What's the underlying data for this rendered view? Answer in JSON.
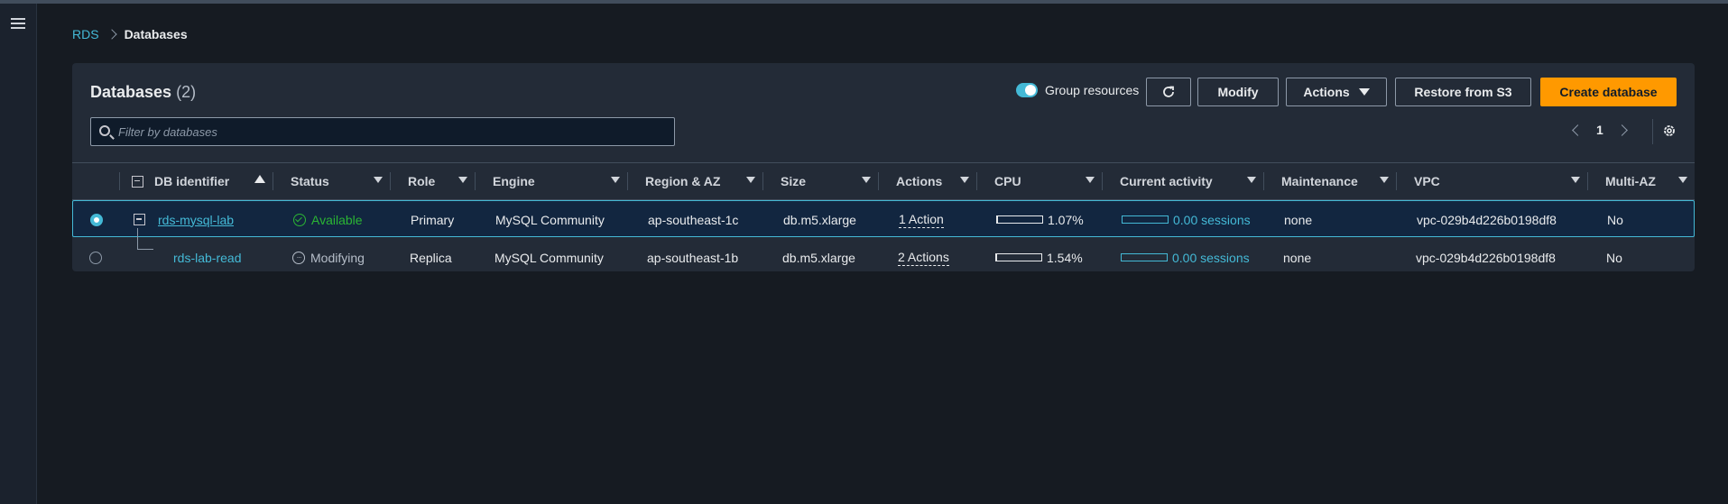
{
  "breadcrumb": {
    "root": "RDS",
    "current": "Databases"
  },
  "panel": {
    "title": "Databases",
    "count": "(2)",
    "group_resources_label": "Group resources",
    "buttons": {
      "modify": "Modify",
      "actions": "Actions",
      "restore": "Restore from S3",
      "create": "Create database"
    },
    "search_placeholder": "Filter by databases",
    "page": "1"
  },
  "columns": [
    "DB identifier",
    "Status",
    "Role",
    "Engine",
    "Region & AZ",
    "Size",
    "Actions",
    "CPU",
    "Current activity",
    "Maintenance",
    "VPC",
    "Multi-AZ"
  ],
  "rows": [
    {
      "id": "rds-mysql-lab",
      "status": "Available",
      "role": "Primary",
      "engine": "MySQL Community",
      "region": "ap-southeast-1c",
      "size": "db.m5.xlarge",
      "actions": "1 Action",
      "cpu": "1.07%",
      "cpu_fraction": 0.0107,
      "activity": "0.00 sessions",
      "maintenance": "none",
      "vpc": "vpc-029b4d226b0198df8",
      "multi_az": "No",
      "selected": true
    },
    {
      "id": "rds-lab-read",
      "status": "Modifying",
      "role": "Replica",
      "engine": "MySQL Community",
      "region": "ap-southeast-1b",
      "size": "db.m5.xlarge",
      "actions": "2 Actions",
      "cpu": "1.54%",
      "cpu_fraction": 0.0154,
      "activity": "0.00 sessions",
      "maintenance": "none",
      "vpc": "vpc-029b4d226b0198df8",
      "multi_az": "No",
      "selected": false
    }
  ],
  "colors": {
    "accent": "#44b9d6",
    "primary_button": "#ff9900",
    "success": "#2bb534"
  }
}
